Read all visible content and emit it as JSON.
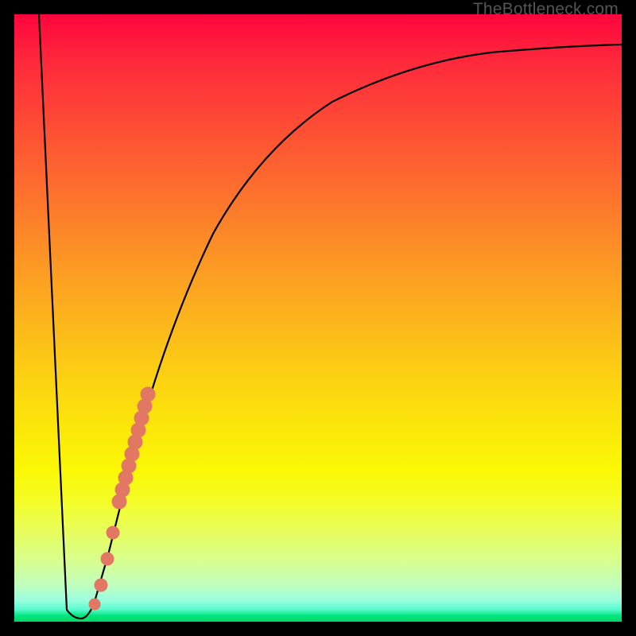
{
  "watermark": "TheBottleneck.com",
  "chart_data": {
    "type": "line",
    "title": "",
    "xlabel": "",
    "ylabel": "",
    "xlim": [
      0,
      100
    ],
    "ylim": [
      0,
      100
    ],
    "series": [
      {
        "name": "bottleneck-curve",
        "x": [
          4,
          8,
          10,
          11,
          12,
          14,
          16,
          18,
          20,
          22,
          25,
          30,
          35,
          40,
          50,
          60,
          70,
          80,
          90,
          100
        ],
        "y": [
          100,
          2,
          1,
          1,
          2,
          8,
          18,
          28,
          37,
          45,
          55,
          67,
          75,
          80,
          86,
          89.5,
          91.5,
          93,
          94,
          94.5
        ]
      }
    ],
    "markers": {
      "name": "highlighted-points",
      "color": "#e27863",
      "points": [
        {
          "x": 13.2,
          "y": 4
        },
        {
          "x": 14.2,
          "y": 8
        },
        {
          "x": 15.0,
          "y": 12
        },
        {
          "x": 15.8,
          "y": 16
        },
        {
          "x": 17.2,
          "y": 23
        },
        {
          "x": 18.0,
          "y": 27
        },
        {
          "x": 18.8,
          "y": 31
        },
        {
          "x": 19.6,
          "y": 35
        },
        {
          "x": 20.4,
          "y": 38.5
        },
        {
          "x": 21.2,
          "y": 42
        },
        {
          "x": 22.0,
          "y": 45
        }
      ]
    }
  }
}
